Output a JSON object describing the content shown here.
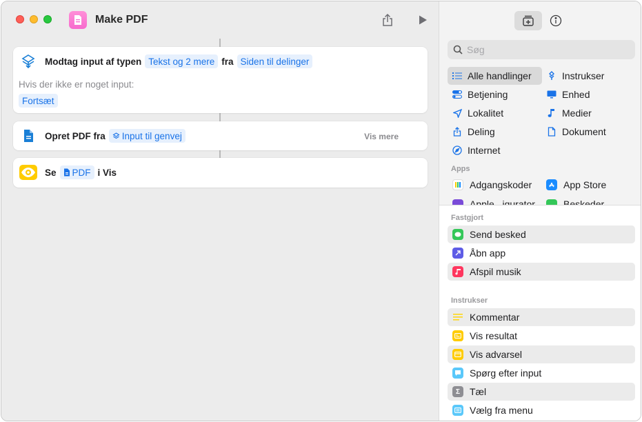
{
  "window": {
    "title": "Make PDF"
  },
  "editor": {
    "actions": [
      {
        "name": "receive-input",
        "label": "Modtag input af typen",
        "type_token": "Tekst og 2 mere",
        "from_label": "fra",
        "source_token": "Siden til delinger",
        "no_input_label": "Hvis der ikke er noget input:",
        "no_input_token": "Fortsæt"
      },
      {
        "name": "create-pdf",
        "label": "Opret PDF fra",
        "input_token": "Input til genvej",
        "show_more": "Vis mere"
      },
      {
        "name": "quick-look",
        "label": "Se",
        "pdf_token": "PDF",
        "suffix": "i Vis"
      }
    ]
  },
  "library": {
    "search": {
      "placeholder": "Søg"
    },
    "categories": [
      {
        "label": "Alle handlinger",
        "icon": "list-icon",
        "selected": true
      },
      {
        "label": "Instrukser",
        "icon": "scripting-icon"
      },
      {
        "label": "Betjening",
        "icon": "toggle-icon"
      },
      {
        "label": "Enhed",
        "icon": "display-icon"
      },
      {
        "label": "Lokalitet",
        "icon": "location-icon"
      },
      {
        "label": "Medier",
        "icon": "music-note-icon"
      },
      {
        "label": "Deling",
        "icon": "share-icon"
      },
      {
        "label": "Dokument",
        "icon": "document-icon"
      },
      {
        "label": "Internet",
        "icon": "compass-icon"
      }
    ],
    "apps_label": "Apps",
    "apps": [
      {
        "label": "Adgangskoder",
        "icon": "passwords-icon"
      },
      {
        "label": "App Store",
        "icon": "app-store-icon"
      },
      {
        "label": "Apple...igurator",
        "icon": "configurator-icon"
      },
      {
        "label": "Beskeder",
        "icon": "messages-icon"
      }
    ],
    "pinned_label": "Fastgjort",
    "pinned": [
      {
        "label": "Send besked",
        "icon": "message-icon",
        "color": "#34c759"
      },
      {
        "label": "Åbn app",
        "icon": "open-app-icon",
        "color": "#5e5ce6"
      },
      {
        "label": "Afspil musik",
        "icon": "music-icon",
        "color": "#ff375f"
      }
    ],
    "scripting_label": "Instrukser",
    "scripting": [
      {
        "label": "Kommentar",
        "icon": "comment-icon",
        "color": "#ffd60a"
      },
      {
        "label": "Vis resultat",
        "icon": "show-result-icon",
        "color": "#ffcc00"
      },
      {
        "label": "Vis advarsel",
        "icon": "alert-icon",
        "color": "#ffcc00"
      },
      {
        "label": "Spørg efter input",
        "icon": "ask-input-icon",
        "color": "#5ac8fa"
      },
      {
        "label": "Tæl",
        "icon": "count-icon",
        "color": "#8e8e93"
      },
      {
        "label": "Vælg fra menu",
        "icon": "menu-icon",
        "color": "#5ac8fa"
      }
    ]
  }
}
